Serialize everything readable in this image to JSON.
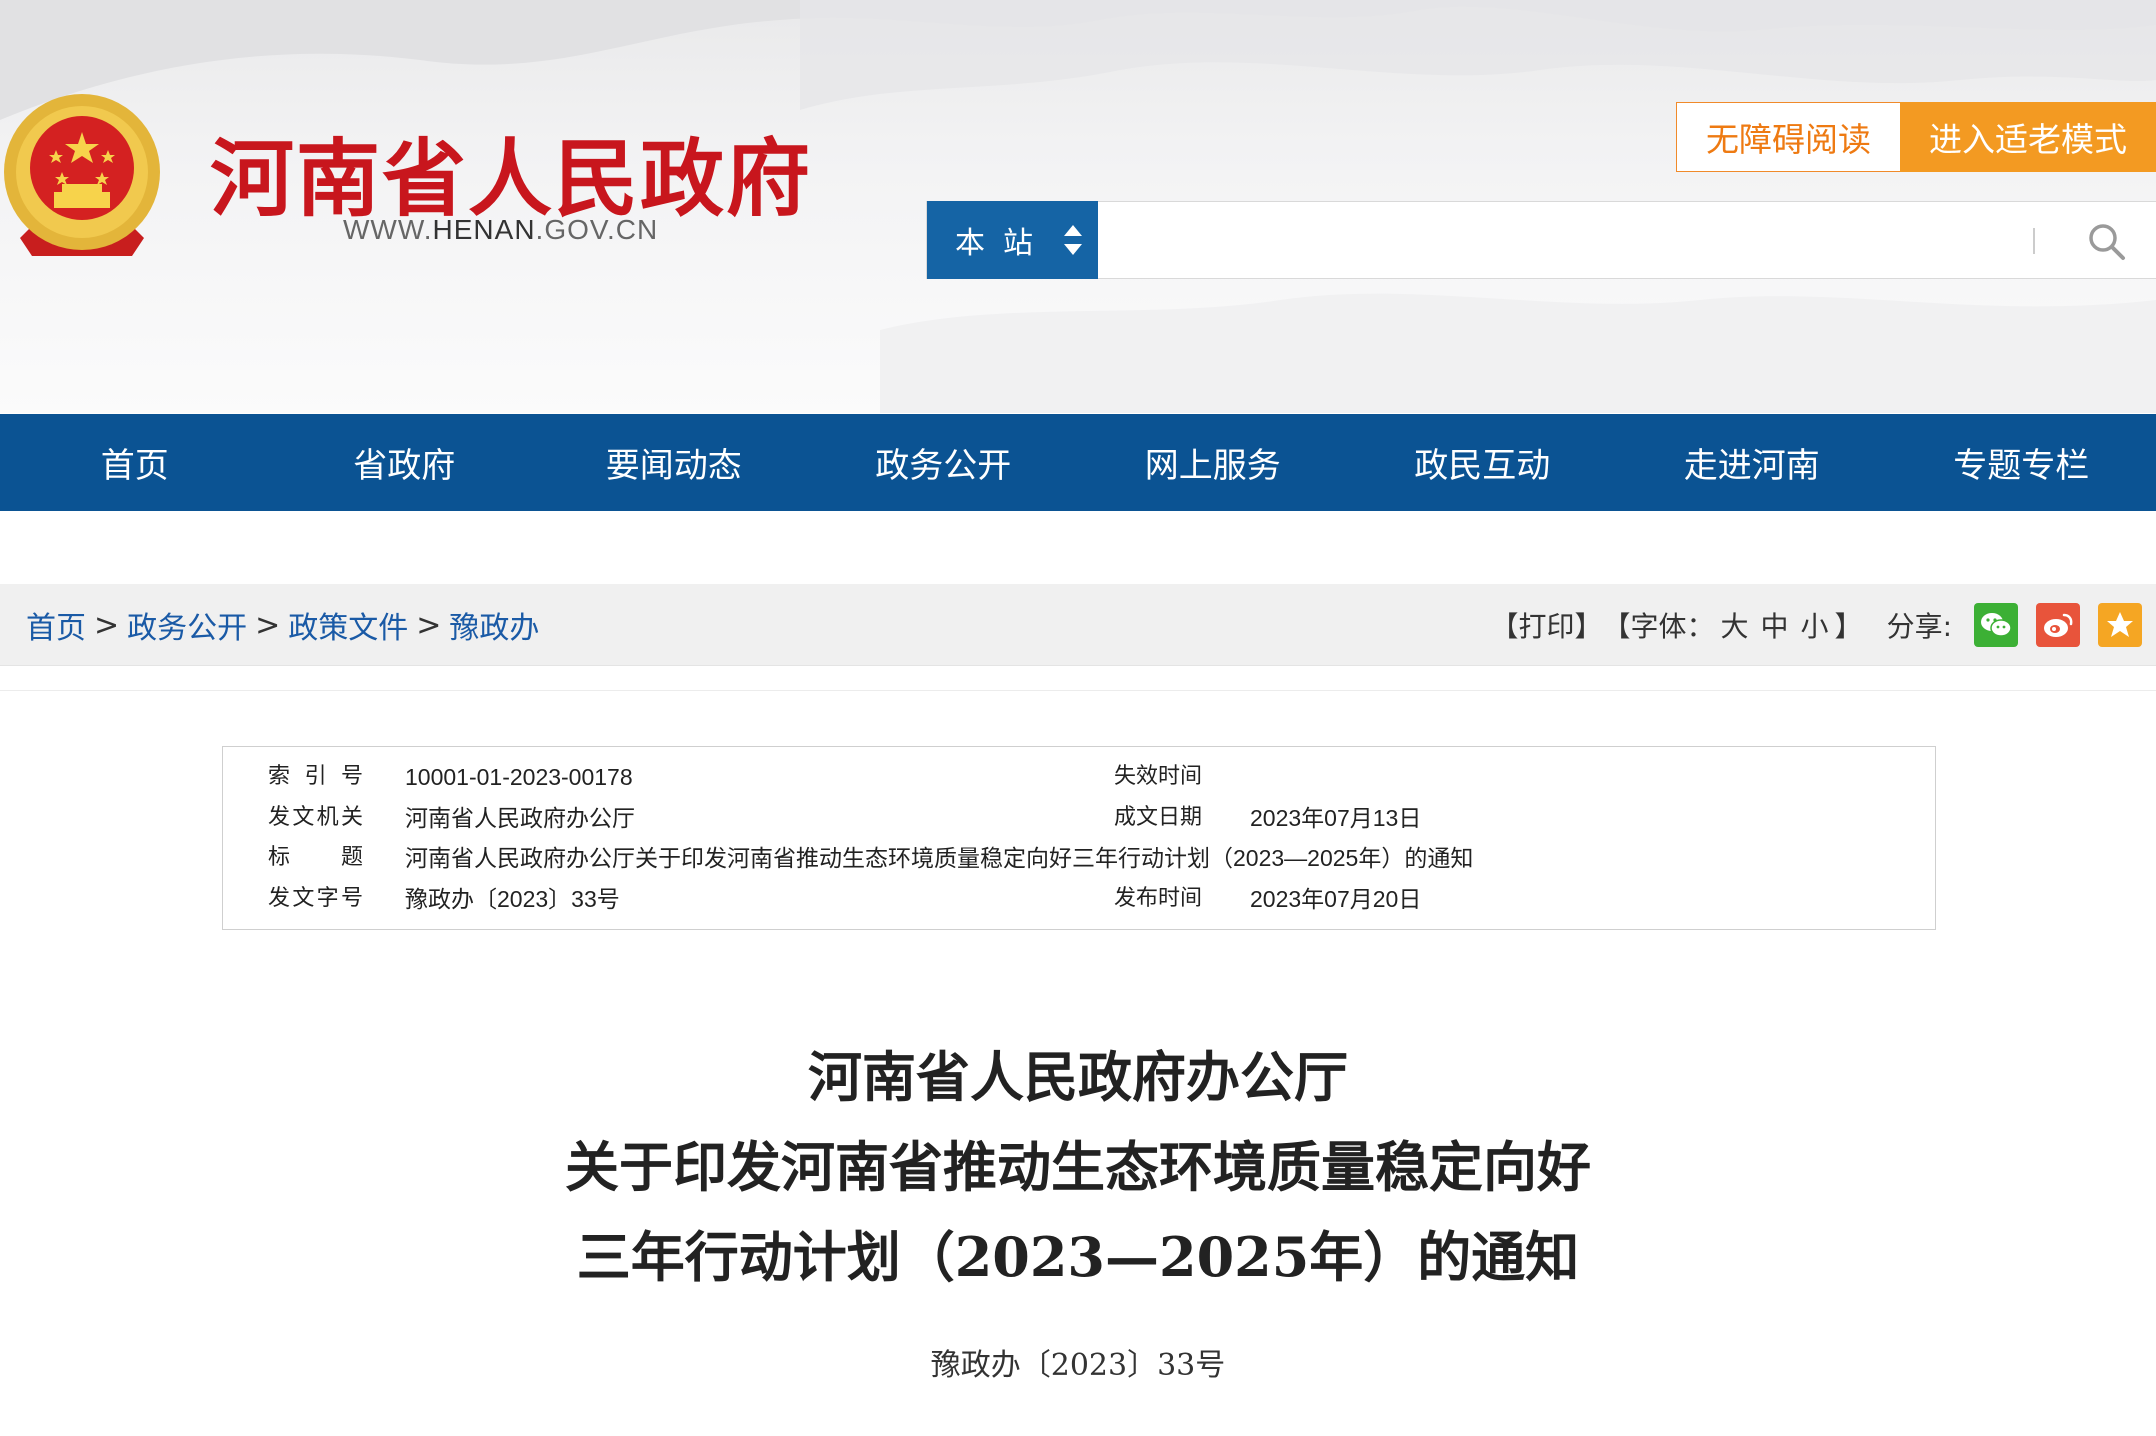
{
  "header": {
    "site_title": "河南省人民政府",
    "site_url_prefix": "WWW.",
    "site_url_highlight": "HENAN",
    "site_url_suffix": ".GOV.CN",
    "accessible_label": "无障碍阅读",
    "elder_mode_label": "进入适老模式",
    "search_scope": "本站",
    "search_placeholder": "",
    "colors": {
      "title_red": "#c8161d",
      "accent_orange": "#f39a22",
      "nav_blue": "#0b5393"
    }
  },
  "nav": {
    "items": [
      "首页",
      "省政府",
      "要闻动态",
      "政务公开",
      "网上服务",
      "政民互动",
      "走进河南",
      "专题专栏"
    ]
  },
  "breadcrumb": {
    "items": [
      "首页",
      "政务公开",
      "政策文件",
      "豫政办"
    ],
    "separator": ">"
  },
  "tools": {
    "print": "【打印】",
    "font_open": "【字体：",
    "size_large": "大",
    "size_medium": "中",
    "size_small": "小",
    "font_close": "】",
    "share_label": "分享:"
  },
  "meta": {
    "index_key": "索 引 号",
    "index_val": "10001-01-2023-00178",
    "expire_key": "失效时间",
    "expire_val": "",
    "issuer_key": "发文机关",
    "issuer_val": "河南省人民政府办公厅",
    "created_key": "成文日期",
    "created_val": "2023年07月13日",
    "title_key": "标　　题",
    "title_val": "河南省人民政府办公厅关于印发河南省推动生态环境质量稳定向好三年行动计划（2023—2025年）的通知",
    "docno_key": "发文字号",
    "docno_val": "豫政办〔2023〕33号",
    "publish_key": "发布时间",
    "publish_val": "2023年07月20日"
  },
  "document": {
    "title_line1": "河南省人民政府办公厅",
    "title_line2": "关于印发河南省推动生态环境质量稳定向好",
    "title_line3": "三年行动计划（2023—2025年）的通知",
    "number": "豫政办〔2023〕33号"
  }
}
